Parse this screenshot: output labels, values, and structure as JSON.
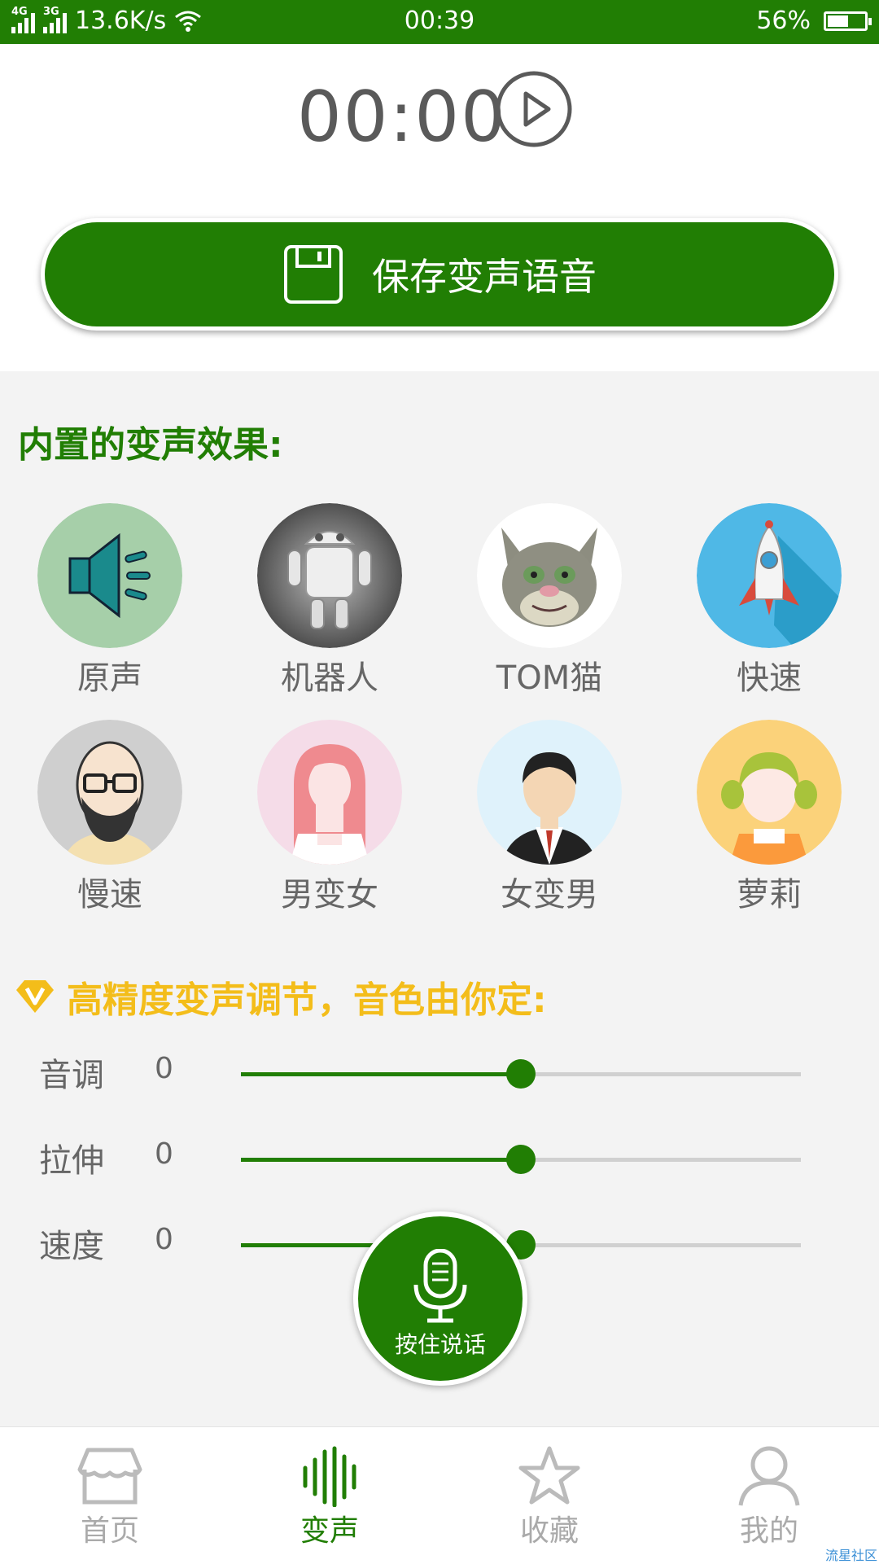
{
  "status_bar": {
    "net1": "4G",
    "net2": "3G",
    "speed": "13.6K/s",
    "time": "00:39",
    "battery": "56%",
    "battery_level": 0.56
  },
  "player": {
    "timer": "00:00"
  },
  "save_button": {
    "label": "保存变声语音"
  },
  "effects": {
    "title": "内置的变声效果:",
    "items": [
      {
        "label": "原声",
        "icon": "speaker-icon"
      },
      {
        "label": "机器人",
        "icon": "robot-avatar"
      },
      {
        "label": "TOM猫",
        "icon": "tom-cat-avatar"
      },
      {
        "label": "快速",
        "icon": "rocket-icon"
      },
      {
        "label": "慢速",
        "icon": "bald-man-avatar"
      },
      {
        "label": "男变女",
        "icon": "girl-avatar"
      },
      {
        "label": "女变男",
        "icon": "man-avatar"
      },
      {
        "label": "萝莉",
        "icon": "little-girl-avatar"
      }
    ]
  },
  "tuning": {
    "title": "高精度变声调节，音色由你定:",
    "sliders": [
      {
        "label": "音调",
        "value": "0",
        "position": 0.5
      },
      {
        "label": "拉伸",
        "value": "0",
        "position": 0.5
      },
      {
        "label": "速度",
        "value": "0",
        "position": 0.5
      }
    ]
  },
  "record_button": {
    "label": "按住说话"
  },
  "nav": {
    "items": [
      {
        "label": "首页",
        "icon": "shop-icon",
        "active": false
      },
      {
        "label": "变声",
        "icon": "waveform-icon",
        "active": true
      },
      {
        "label": "收藏",
        "icon": "star-icon",
        "active": false
      },
      {
        "label": "我的",
        "icon": "user-icon",
        "active": false
      }
    ]
  },
  "watermark": "流星社区",
  "colors": {
    "primary": "#217e04",
    "accent": "#f3bd1a",
    "text": "#666666"
  }
}
